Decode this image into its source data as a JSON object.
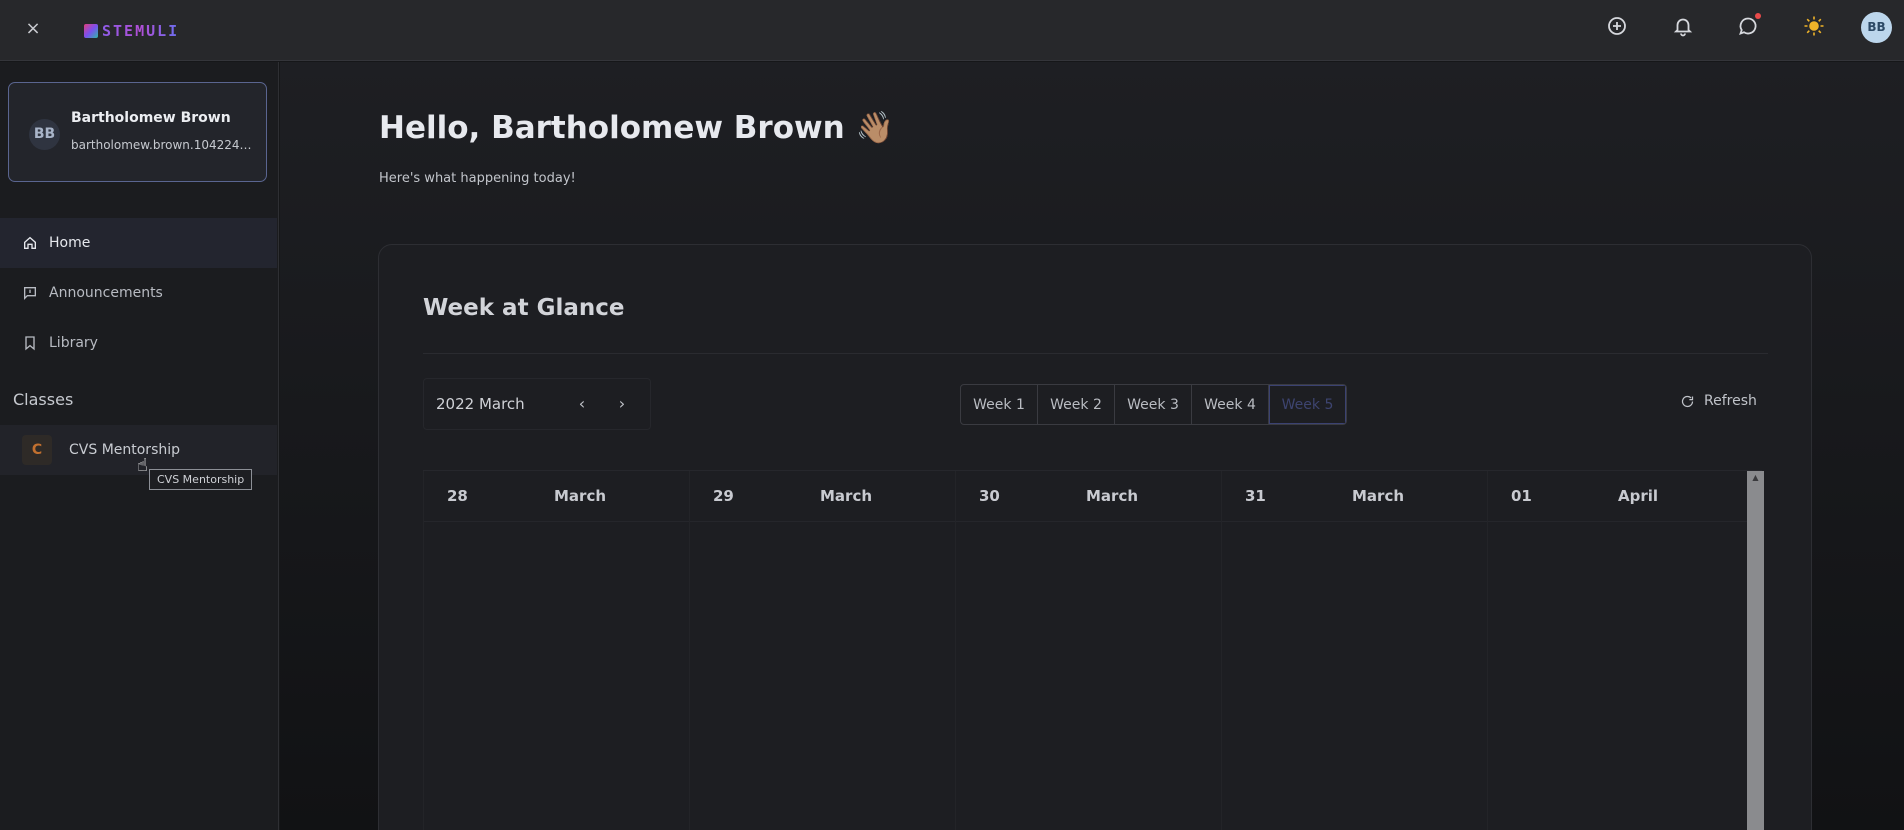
{
  "topbar": {
    "close_label": "×",
    "logo_text": "STEMULI",
    "avatar_initials": "BB"
  },
  "profile": {
    "initials": "BB",
    "name": "Bartholomew Brown",
    "email": "bartholomew.brown.104224@ex..."
  },
  "nav": {
    "items": [
      {
        "label": "Home",
        "icon": "home-icon"
      },
      {
        "label": "Announcements",
        "icon": "announcement-icon"
      },
      {
        "label": "Library",
        "icon": "bookmark-icon"
      }
    ]
  },
  "classes": {
    "heading": "Classes",
    "items": [
      {
        "badge": "C",
        "label": "CVS Mentorship"
      }
    ],
    "tooltip": "CVS Mentorship"
  },
  "main": {
    "greeting": "Hello, Bartholomew Brown 👋🏽",
    "subgreeting": "Here's what happening today!",
    "card_title": "Week at Glance",
    "month_label": "2022 March",
    "prev_arrow": "‹",
    "next_arrow": "›",
    "weeks": [
      "Week 1",
      "Week 2",
      "Week 3",
      "Week 4",
      "Week 5"
    ],
    "selected_week": "Week 5",
    "refresh_label": "Refresh",
    "days": [
      {
        "num": "28",
        "month": "March"
      },
      {
        "num": "29",
        "month": "March"
      },
      {
        "num": "30",
        "month": "March"
      },
      {
        "num": "31",
        "month": "March"
      },
      {
        "num": "01",
        "month": "April"
      }
    ]
  },
  "colors": {
    "accent": "#3b4272",
    "class_badge": "#c2702f",
    "notification_dot": "#e84a4a",
    "theme_sun": "#f0b429"
  }
}
